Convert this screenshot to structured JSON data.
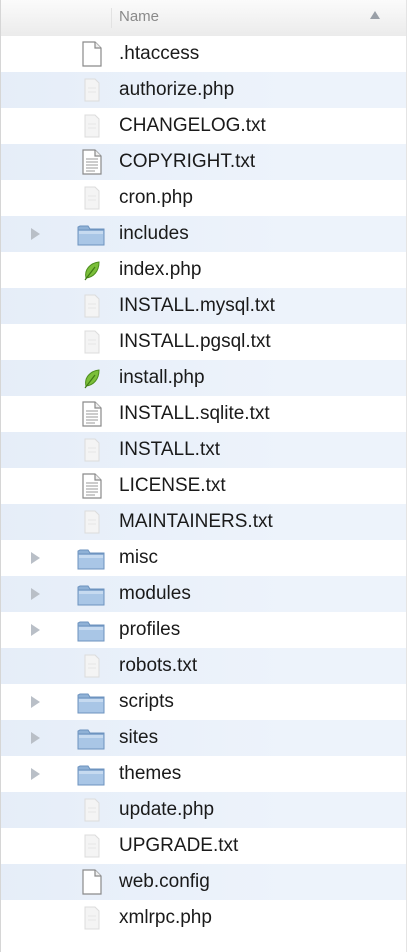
{
  "header": {
    "name_label": "Name"
  },
  "files": [
    {
      "name": ".htaccess",
      "icon": "blank-document-icon",
      "kind": "doc"
    },
    {
      "name": "authorize.php",
      "icon": "php-file-icon",
      "kind": "faint"
    },
    {
      "name": "CHANGELOG.txt",
      "icon": "text-file-icon",
      "kind": "faint"
    },
    {
      "name": "COPYRIGHT.txt",
      "icon": "text-document-icon",
      "kind": "text"
    },
    {
      "name": "cron.php",
      "icon": "php-file-icon",
      "kind": "faint"
    },
    {
      "name": "includes",
      "icon": "folder-icon",
      "kind": "folder"
    },
    {
      "name": "index.php",
      "icon": "leaf-php-icon",
      "kind": "leaf"
    },
    {
      "name": "INSTALL.mysql.txt",
      "icon": "text-file-icon",
      "kind": "faint"
    },
    {
      "name": "INSTALL.pgsql.txt",
      "icon": "text-file-icon",
      "kind": "faint"
    },
    {
      "name": "install.php",
      "icon": "leaf-php-icon",
      "kind": "leaf"
    },
    {
      "name": "INSTALL.sqlite.txt",
      "icon": "text-document-icon",
      "kind": "text"
    },
    {
      "name": "INSTALL.txt",
      "icon": "text-file-icon",
      "kind": "faint"
    },
    {
      "name": "LICENSE.txt",
      "icon": "text-document-icon",
      "kind": "text"
    },
    {
      "name": "MAINTAINERS.txt",
      "icon": "text-file-icon",
      "kind": "faint"
    },
    {
      "name": "misc",
      "icon": "folder-icon",
      "kind": "folder"
    },
    {
      "name": "modules",
      "icon": "folder-icon",
      "kind": "folder"
    },
    {
      "name": "profiles",
      "icon": "folder-icon",
      "kind": "folder"
    },
    {
      "name": "robots.txt",
      "icon": "text-file-icon",
      "kind": "faint"
    },
    {
      "name": "scripts",
      "icon": "folder-icon",
      "kind": "folder"
    },
    {
      "name": "sites",
      "icon": "folder-icon",
      "kind": "folder"
    },
    {
      "name": "themes",
      "icon": "folder-icon",
      "kind": "folder"
    },
    {
      "name": "update.php",
      "icon": "php-file-icon",
      "kind": "faint"
    },
    {
      "name": "UPGRADE.txt",
      "icon": "text-file-icon",
      "kind": "faint"
    },
    {
      "name": "web.config",
      "icon": "blank-document-icon",
      "kind": "doc"
    },
    {
      "name": "xmlrpc.php",
      "icon": "php-file-icon",
      "kind": "faint"
    }
  ]
}
